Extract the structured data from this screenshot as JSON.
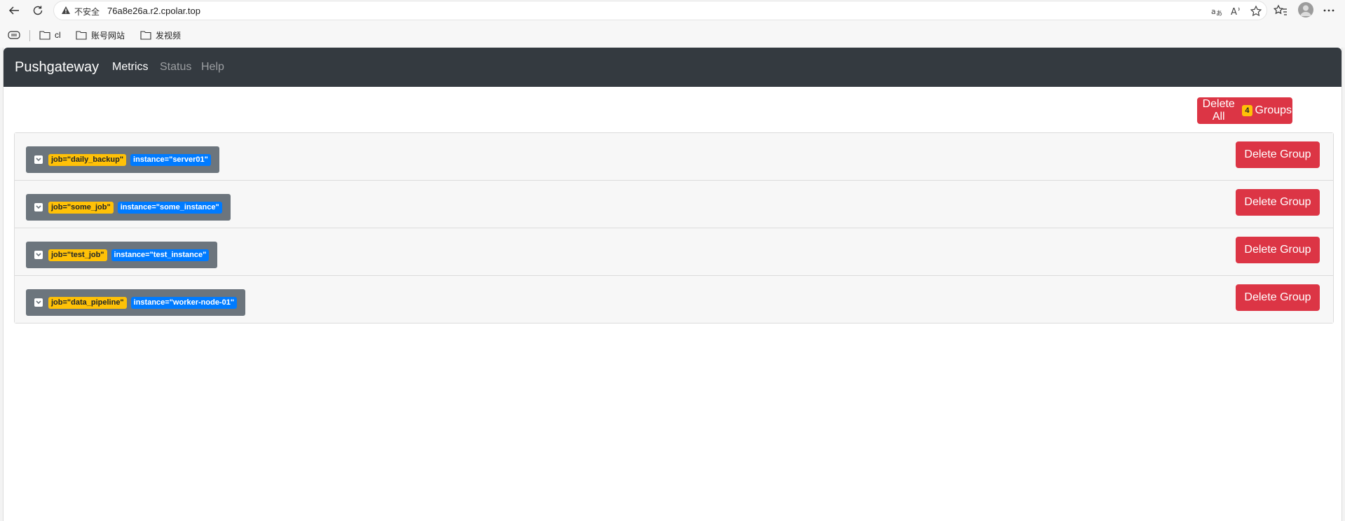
{
  "browser": {
    "insecure_label": "不安全",
    "url": "76a8e26a.r2.cpolar.top",
    "bookmarks": [
      {
        "label": "cl"
      },
      {
        "label": "账号网站"
      },
      {
        "label": "发视频"
      }
    ]
  },
  "navbar": {
    "brand": "Pushgateway",
    "links": [
      {
        "label": "Metrics",
        "active": true
      },
      {
        "label": "Status",
        "active": false
      },
      {
        "label": "Help",
        "active": false
      }
    ]
  },
  "delete_all": {
    "prefix": "Delete All",
    "count": "4",
    "suffix": "Groups"
  },
  "groups": [
    {
      "job": "job=\"daily_backup\"",
      "instance": "instance=\"server01\"",
      "delete_label": "Delete Group"
    },
    {
      "job": "job=\"some_job\"",
      "instance": "instance=\"some_instance\"",
      "delete_label": "Delete Group"
    },
    {
      "job": "job=\"test_job\"",
      "instance": "instance=\"test_instance\"",
      "delete_label": "Delete Group"
    },
    {
      "job": "job=\"data_pipeline\"",
      "instance": "instance=\"worker-node-01\"",
      "delete_label": "Delete Group"
    }
  ],
  "colors": {
    "navbar_bg": "#343a40",
    "danger": "#dc3545",
    "job_badge": "#ffc107",
    "instance_badge": "#007bff",
    "group_label_bg": "#6c757d"
  }
}
